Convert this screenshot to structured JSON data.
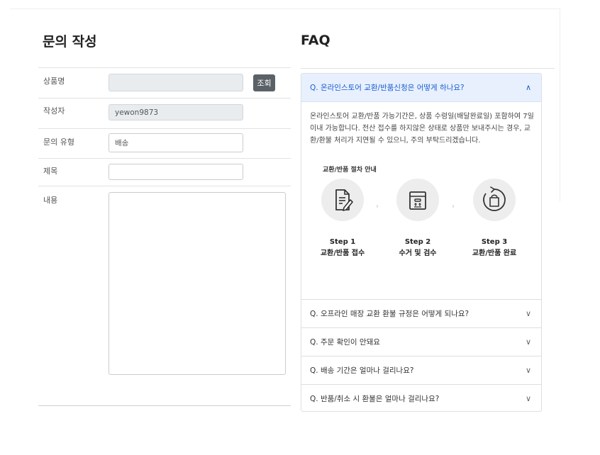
{
  "form": {
    "title": "문의 작성",
    "fields": {
      "product": {
        "label": "상품명",
        "value": ""
      },
      "author": {
        "label": "작성자",
        "value": "yewon9873"
      },
      "type": {
        "label": "문의 유형",
        "value": "배송"
      },
      "subject": {
        "label": "제목",
        "value": ""
      },
      "content": {
        "label": "내용",
        "value": ""
      }
    },
    "lookup_label": "조회"
  },
  "faq": {
    "title": "FAQ",
    "open_item": {
      "question": "Q. 온라인스토어 교환/반품신청은 어떻게 하나요?",
      "answer": "온라인스토어 교환/반품 가능기간은, 상품 수령일(배달완료일) 포함하여 7일 이내 가능합니다. 전산 접수를 하지않은 상태로 상품만 보내주시는 경우, 교환/환불 처리가 지연될 수 있으니, 주의 부탁드리겠습니다.",
      "guide_title": "교환/반품 절차 안내",
      "steps": [
        {
          "num": "Step 1",
          "desc": "교환/반품 접수",
          "icon": "document-edit-icon"
        },
        {
          "num": "Step 2",
          "desc": "수거 및 검수",
          "icon": "box-icon"
        },
        {
          "num": "Step 3",
          "desc": "교환/반품 완료",
          "icon": "exchange-cycle-icon"
        }
      ],
      "chevron": "∧"
    },
    "items": [
      {
        "question": "Q. 오프라인 매장 교환 환불 규정은 어떻게 되나요?"
      },
      {
        "question": "Q. 주문 확인이 안돼요"
      },
      {
        "question": "Q. 배송 기간은 얼마나 걸리나요?"
      },
      {
        "question": "Q. 반품/취소 시 환불은 얼마나 걸리나요?"
      }
    ],
    "closed_chevron": "∨"
  },
  "colors": {
    "accent": "#1a5fd0",
    "open_header_bg": "#e8f0fe",
    "lookup_button": "#5a6268"
  }
}
